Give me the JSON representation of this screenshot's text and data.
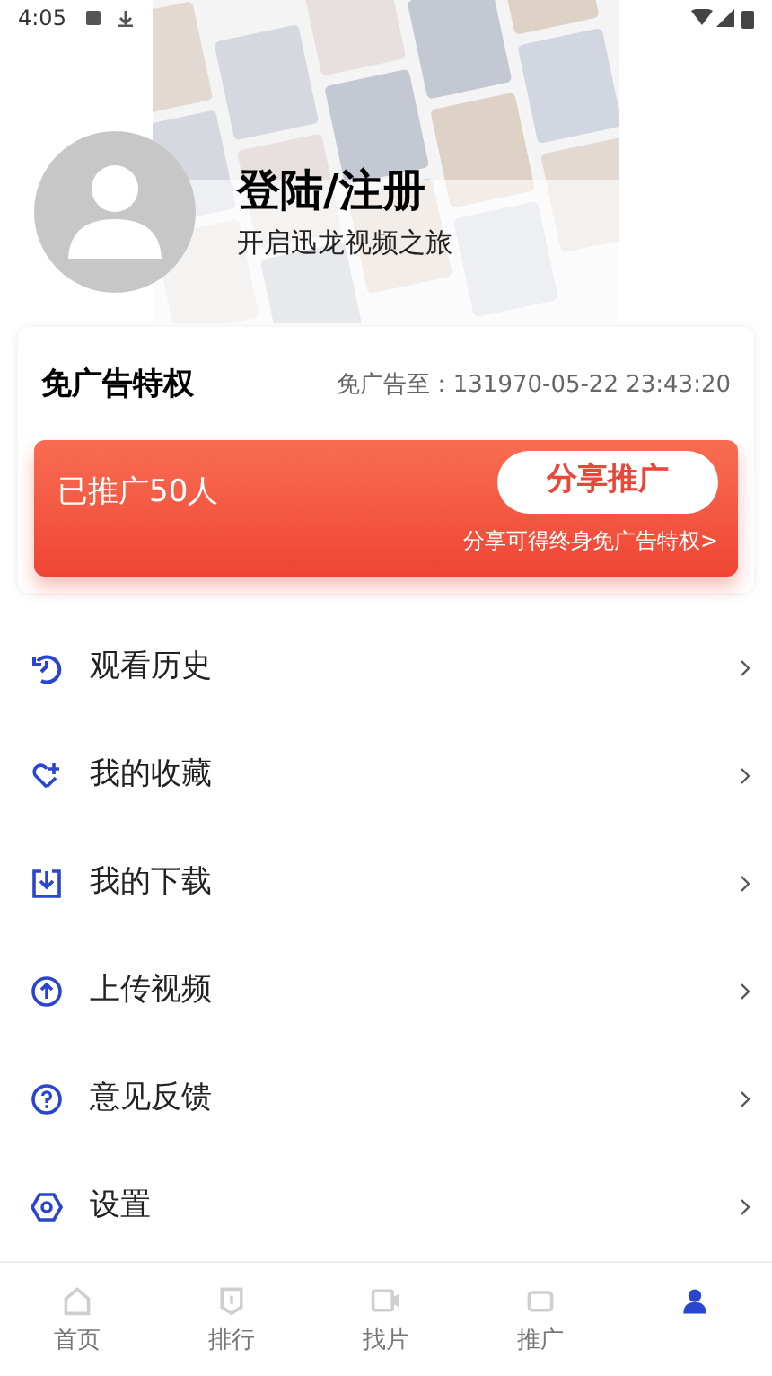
{
  "status_bar": {
    "time": "4:05"
  },
  "profile": {
    "title": "登陆/注册",
    "subtitle": "开启迅龙视频之旅"
  },
  "ad_free": {
    "title": "免广告特权",
    "expiry": "免广告至：131970-05-22 23:43:20",
    "promoted": "已推广50人",
    "share_button": "分享推广",
    "share_hint": "分享可得终身免广告特权>"
  },
  "menu": [
    {
      "kind": "history",
      "label": "观看历史"
    },
    {
      "kind": "favorites",
      "label": "我的收藏"
    },
    {
      "kind": "download",
      "label": "我的下载"
    },
    {
      "kind": "upload",
      "label": "上传视频"
    },
    {
      "kind": "feedback",
      "label": "意见反馈"
    },
    {
      "kind": "settings",
      "label": "设置"
    }
  ],
  "tab_bar": [
    {
      "kind": "home",
      "label": "首页",
      "selected": false
    },
    {
      "kind": "ranking",
      "label": "排行",
      "selected": false
    },
    {
      "kind": "find",
      "label": "找片",
      "selected": false
    },
    {
      "kind": "promote",
      "label": "推广",
      "selected": false
    },
    {
      "kind": "mine",
      "selected": true
    }
  ]
}
